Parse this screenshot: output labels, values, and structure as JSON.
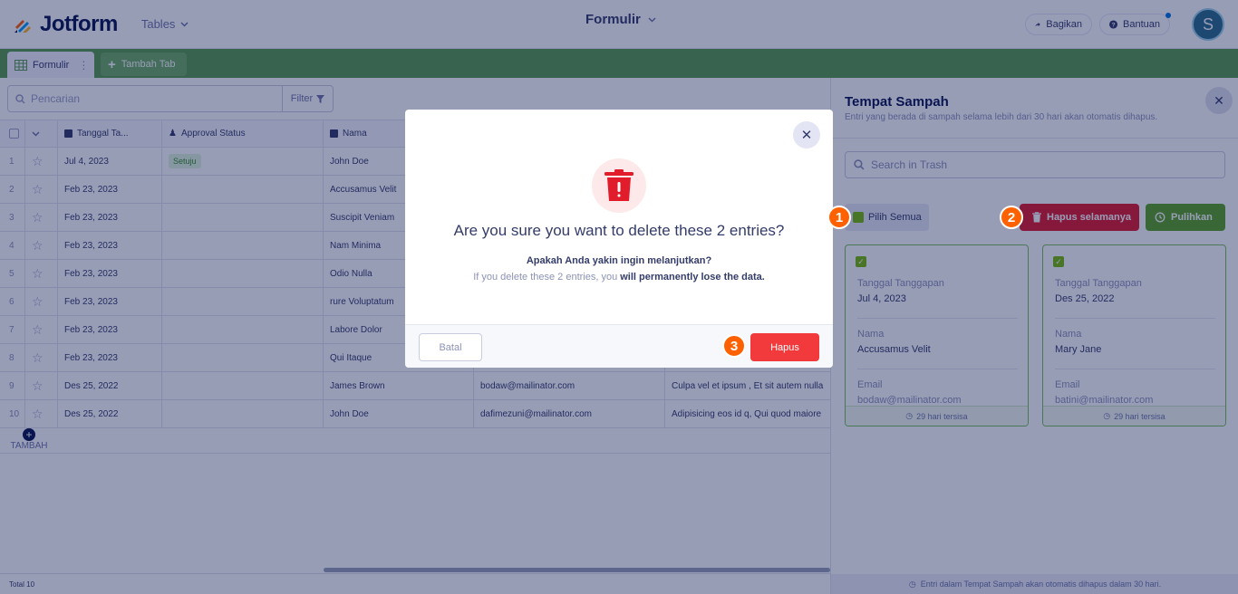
{
  "header": {
    "logo_text": "Jotform",
    "tables_label": "Tables",
    "form_title": "Formulir",
    "share_label": "Bagikan",
    "help_label": "Bantuan",
    "avatar_initial": "S"
  },
  "tabs": {
    "active_label": "Formulir",
    "add_label": "Tambah Tab"
  },
  "table": {
    "search_placeholder": "Pencarian",
    "filter_label": "Filter",
    "columns": [
      "Tanggal Ta...",
      "Approval Status",
      "Nama"
    ],
    "rows": [
      {
        "num": "1",
        "date": "Jul 4, 2023",
        "status": "Setuju",
        "name": "John Doe",
        "email": "",
        "msg": ""
      },
      {
        "num": "2",
        "date": "Feb 23, 2023",
        "status": "",
        "name": "Accusamus Velit",
        "email": "",
        "msg": ""
      },
      {
        "num": "3",
        "date": "Feb 23, 2023",
        "status": "",
        "name": "Suscipit Veniam",
        "email": "",
        "msg": ""
      },
      {
        "num": "4",
        "date": "Feb 23, 2023",
        "status": "",
        "name": "Nam Minima",
        "email": "",
        "msg": ""
      },
      {
        "num": "5",
        "date": "Feb 23, 2023",
        "status": "",
        "name": "Odio Nulla",
        "email": "",
        "msg": ""
      },
      {
        "num": "6",
        "date": "Feb 23, 2023",
        "status": "",
        "name": "rure Voluptatum",
        "email": "",
        "msg": ""
      },
      {
        "num": "7",
        "date": "Feb 23, 2023",
        "status": "",
        "name": "Labore Dolor",
        "email": "",
        "msg": ""
      },
      {
        "num": "8",
        "date": "Feb 23, 2023",
        "status": "",
        "name": "Qui Itaque",
        "email": "",
        "msg": ""
      },
      {
        "num": "9",
        "date": "Des 25, 2022",
        "status": "",
        "name": "James Brown",
        "email": "bodaw@mailinator.com",
        "msg": "Culpa vel et ipsum , Et sit autem nulla"
      },
      {
        "num": "10",
        "date": "Des 25, 2022",
        "status": "",
        "name": "John Doe",
        "email": "dafimezuni@mailinator.com",
        "msg": "Adipisicing eos id q, Qui quod maiore"
      }
    ],
    "add_label": "TAMBAH",
    "total_label": "Total 10"
  },
  "trash": {
    "title": "Tempat Sampah",
    "subtitle": "Entri yang berada di sampah selama lebih dari 30 hari akan otomatis dihapus.",
    "search_placeholder": "Search in Trash",
    "select_all_label": "Pilih Semua",
    "delete_forever_label": "Hapus selamanya",
    "restore_label": "Pulihkan",
    "cards": [
      {
        "date_label": "Tanggal Tanggapan",
        "date": "Jul 4, 2023",
        "name_label": "Nama",
        "name": "Accusamus Velit",
        "email_label": "Email",
        "email": "bodaw@mailinator.com",
        "remaining": "29 hari tersisa"
      },
      {
        "date_label": "Tanggal Tanggapan",
        "date": "Des 25, 2022",
        "name_label": "Nama",
        "name": "Mary Jane",
        "email_label": "Email",
        "email": "batini@mailinator.com",
        "remaining": "29 hari tersisa"
      }
    ],
    "footer_note": "Entri dalam Tempat Sampah akan otomatis dihapus dalam 30 hari."
  },
  "modal": {
    "question": "Are you sure you want to delete these 2 entries?",
    "subtitle": "Apakah Anda yakin ingin melanjutkan?",
    "warning_prefix": "If you delete these 2 entries, you ",
    "warning_strong": "will permanently lose the data.",
    "cancel_label": "Batal",
    "delete_label": "Hapus"
  },
  "steps": [
    "1",
    "2",
    "3"
  ],
  "colors": {
    "brand_green": "#5b9c4f",
    "danger_red": "#e11d2b",
    "delete_button": "#f23a3c",
    "restore_green": "#5ea323",
    "step_badge": "#ff6100"
  }
}
